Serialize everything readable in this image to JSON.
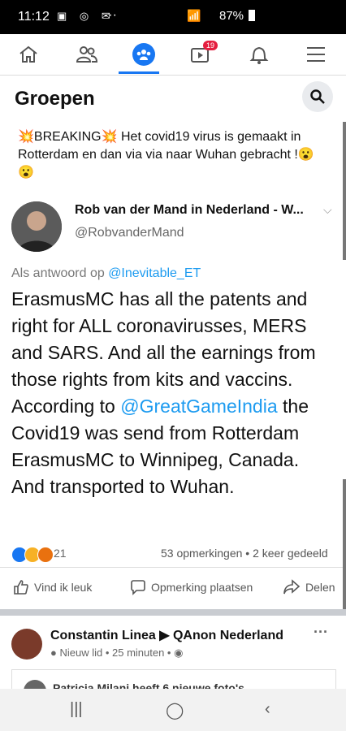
{
  "status": {
    "time": "11:12",
    "battery": "87%"
  },
  "nav": {
    "badge": "19"
  },
  "header": {
    "title": "Groepen"
  },
  "post": {
    "headline_prefix": "💥BREAKING💥",
    "headline_text": "Het covid19 virus is gemaakt in Rotterdam en dan via via naar Wuhan gebracht !😮😮",
    "author": "Rob van der Mand in Nederland - W...",
    "handle": "@RobvanderMand",
    "reply_prefix": "Als antwoord op",
    "reply_mention": "@Inevitable_ET",
    "body_part1": "ErasmusMC has all the patents and right for ALL coronavirusses, MERS and SARS. And all the earnings from those rights from kits and vaccins. According to",
    "body_mention": "@GreatGameIndia",
    "body_part2": "the Covid19 was send from Rotterdam ErasmusMC to Winnipeg, Canada. And transported to Wuhan.",
    "reaction_count": "21",
    "comments_shares": "53 opmerkingen • 2 keer gedeeld",
    "actions": {
      "like": "Vind ik leuk",
      "comment": "Opmerking plaatsen",
      "share": "Delen"
    }
  },
  "post2": {
    "title": "Constantin Linea ▶ QAnon Nederland",
    "sub": "Nieuw lid • 25 minuten •",
    "inner": "Patricia Milani heeft 6 nieuwe foto's"
  }
}
